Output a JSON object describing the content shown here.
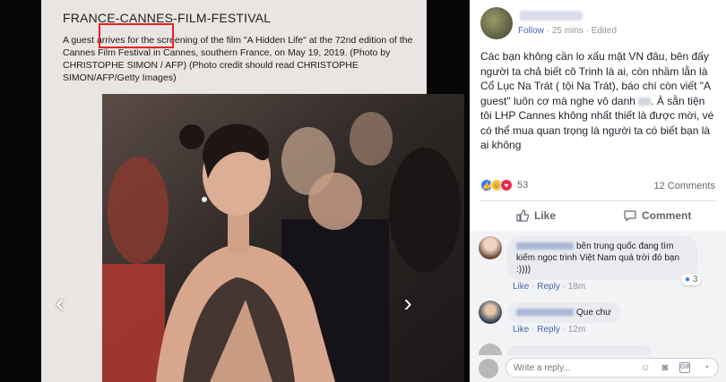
{
  "article": {
    "title": "FRANCE-CANNES-FILM-FESTIVAL",
    "caption": "A guest arrives for the screening of the film \"A Hidden Life\" at the 72nd edition of the Cannes Film Festival in Cannes, southern France, on May 19, 2019. (Photo by CHRISTOPHE SIMON / AFP) (Photo credit should read CHRISTOPHE SIMON/AFP/Getty Images)"
  },
  "viewer": {
    "prev_arrow": "‹",
    "next_arrow": "›"
  },
  "post": {
    "follow": "Follow",
    "time": "25 mins",
    "edited": "Edited",
    "text_a": "Các bạn không cần lo xấu mặt VN đâu, bên đấy người ta chả biết cô Trinh là ai, còn nhầm lẫn là Cổ Lục Na Trát ( tội Na Trát), báo chí còn viết \"A guest\" luôn cơ mà nghe vô danh",
    "text_b": ". À sẵn tiện tôi LHP Cannes không nhất thiết là được mời, vé có thể mua quan trọng là người ta có biết bạn là ai không",
    "reaction_count": "53",
    "comment_count": "12 Comments",
    "like_label": "Like",
    "comment_label": "Comment"
  },
  "comments": [
    {
      "text": "bên trung quốc đang tìm kiếm ngọc trinh Việt Nam quá trời đó bạn :))))",
      "like": "Like",
      "reply": "Reply",
      "time": "18m",
      "reactions": "3"
    },
    {
      "text": "Que chư",
      "like": "Like",
      "reply": "Reply",
      "time": "12m"
    }
  ],
  "reply_bar": {
    "placeholder": "Write a reply..."
  },
  "colors": {
    "link_blue": "#4267b2",
    "highlight_red": "#e8211f",
    "panel_bg": "#ffffff"
  }
}
